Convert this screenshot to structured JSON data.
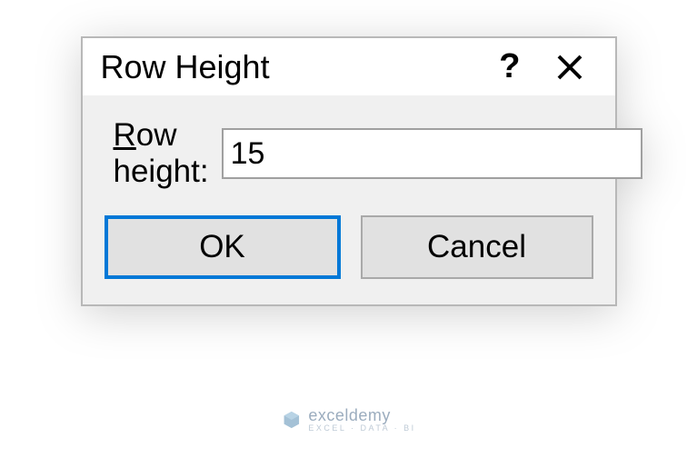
{
  "dialog": {
    "title": "Row Height",
    "help_symbol": "?",
    "field_label_pre": "R",
    "field_label_post": "ow height:",
    "field_value": "15",
    "ok_label": "OK",
    "cancel_label": "Cancel"
  },
  "watermark": {
    "brand": "exceldemy",
    "tagline": "EXCEL · DATA · BI"
  }
}
